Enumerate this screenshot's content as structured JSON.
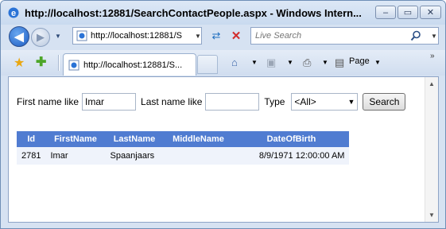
{
  "window": {
    "title": "http://localhost:12881/SearchContactPeople.aspx - Windows Intern...",
    "buttons": {
      "minimize": "‒",
      "maximize": "▭",
      "close": "✕"
    }
  },
  "address_bar": {
    "url": "http://localhost:12881/S",
    "search_placeholder": "Live Search"
  },
  "tab": {
    "title": "http://localhost:12881/S..."
  },
  "toolbar": {
    "page_label": "Page"
  },
  "form": {
    "first_name_label": "First name like",
    "first_name_value": "Imar",
    "last_name_label": "Last name like",
    "last_name_value": "",
    "type_label": "Type",
    "type_selected": "<All>",
    "search_button": "Search"
  },
  "grid": {
    "columns": [
      "Id",
      "FirstName",
      "LastName",
      "MiddleName",
      "DateOfBirth"
    ],
    "rows": [
      {
        "id": "2781",
        "first": "Imar",
        "last": "Spaanjaars",
        "middle": "",
        "dob": "8/9/1971 12:00:00 AM"
      }
    ],
    "header_color": "#507cd1",
    "row_color": "#eff3fb"
  },
  "icons": [
    "ie-icon",
    "back-icon",
    "forward-icon",
    "page-icon",
    "refresh-icon",
    "stop-icon",
    "search-icon",
    "favorites-star-icon",
    "add-favorites-icon",
    "home-icon",
    "feeds-icon",
    "print-icon",
    "page-menu-icon"
  ]
}
